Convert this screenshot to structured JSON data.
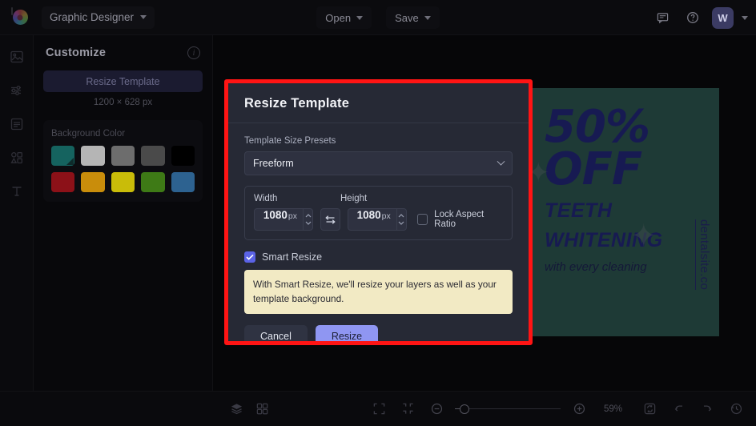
{
  "topbar": {
    "logo_icon": "color-wheel-logo",
    "document_title": "Graphic Designer",
    "menus": [
      {
        "label": "Open",
        "icon": "chevron-down-icon"
      },
      {
        "label": "Save",
        "icon": "chevron-down-icon"
      }
    ],
    "right_icons": [
      {
        "name": "comment-icon",
        "glyph": "☐"
      },
      {
        "name": "help-icon",
        "glyph": "?"
      }
    ],
    "avatar_initial": "W",
    "avatar_chevron": "chevron-down-icon"
  },
  "rail": {
    "items": [
      {
        "name": "image-icon",
        "label": "Image"
      },
      {
        "name": "adjustments-icon",
        "label": "Adjust"
      },
      {
        "name": "page-icon",
        "label": "Page"
      },
      {
        "name": "elements-icon",
        "label": "Elements"
      },
      {
        "name": "text-icon",
        "label": "Text"
      }
    ]
  },
  "panel": {
    "title": "Customize",
    "info_icon": "info-icon",
    "resize_button": "Resize Template",
    "dimensions": "1200 × 628 px",
    "background_color_label": "Background Color",
    "swatches": [
      {
        "color": "#15635f",
        "selected": true
      },
      {
        "color": "#b5b5b5",
        "selected": false
      },
      {
        "color": "#6d6d6d",
        "selected": false
      },
      {
        "color": "#4a4a4a",
        "selected": false
      },
      {
        "color": "#000000",
        "selected": false
      },
      {
        "color": "#8c1118",
        "selected": false
      },
      {
        "color": "#c98d0b",
        "selected": false
      },
      {
        "color": "#c9bc09",
        "selected": false
      },
      {
        "color": "#3e7a16",
        "selected": false
      },
      {
        "color": "#2d6290",
        "selected": false
      }
    ]
  },
  "canvas": {
    "background": "#1e3a36",
    "headline_1": "50%",
    "headline_2": "OFF",
    "subhead_1": "TEETH",
    "subhead_2": "WHITENING",
    "tagline": "with every cleaning",
    "url": "dentalsite.co"
  },
  "modal": {
    "title": "Resize Template",
    "presets_label": "Template Size Presets",
    "preset_selected": "Freeform",
    "preset_chevron": "chevron-down-icon",
    "width_label": "Width",
    "height_label": "Height",
    "width_value": "1080",
    "width_unit": "px",
    "height_value": "1080",
    "height_unit": "px",
    "swap_icon": "swap-dimensions-icon",
    "lock_aspect_label": "Lock Aspect Ratio",
    "lock_aspect_checked": false,
    "smart_resize_label": "Smart Resize",
    "smart_resize_checked": true,
    "notice_text": "With Smart Resize, we'll resize your layers as well as your template background.",
    "cancel_label": "Cancel",
    "resize_label": "Resize",
    "highlight_color": "#ff1414",
    "primary_color": "#8f96f2"
  },
  "bottombar": {
    "left_icons": [
      {
        "name": "layers-icon"
      },
      {
        "name": "grid-icon"
      }
    ],
    "mid_icons": [
      {
        "name": "fit-screen-icon"
      },
      {
        "name": "fit-selection-icon"
      }
    ],
    "zoom_out_icon": "zoom-out-icon",
    "zoom_in_icon": "zoom-in-icon",
    "zoom_level": "59%",
    "right_icons": [
      {
        "name": "reset-view-icon"
      },
      {
        "name": "undo-icon"
      },
      {
        "name": "redo-icon"
      },
      {
        "name": "history-icon"
      }
    ]
  }
}
